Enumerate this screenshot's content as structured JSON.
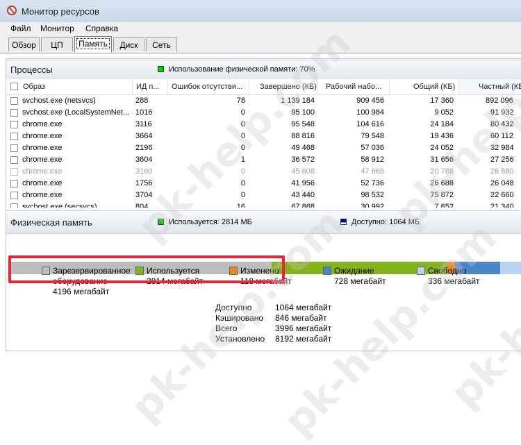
{
  "window": {
    "title": "Монитор ресурсов"
  },
  "menu": [
    "Файл",
    "Монитор",
    "Справка"
  ],
  "tabs": [
    {
      "label": "Обзор",
      "active": false
    },
    {
      "label": "ЦП",
      "active": false
    },
    {
      "label": "Память",
      "active": true
    },
    {
      "label": "Диск",
      "active": false
    },
    {
      "label": "Сеть",
      "active": false
    }
  ],
  "processes": {
    "title": "Процессы",
    "usage_label": "Использование физической памяти: 70%",
    "usage_color": "#00d000",
    "columns": [
      "Образ",
      "ИД п...",
      "Ошибок отсутстви...",
      "Завершено (КБ)",
      "Рабочий набо...",
      "Общий (КБ)",
      "Частный (КБ"
    ],
    "rows": [
      {
        "name": "svchost.exe (netsvcs)",
        "pid": "288",
        "faults": "78",
        "commit": "1 139 184",
        "working": "909 456",
        "shared": "17 360",
        "private": "892 096",
        "grey": false
      },
      {
        "name": "svchost.exe (LocalSystemNet...",
        "pid": "1016",
        "faults": "0",
        "commit": "95 100",
        "working": "100 984",
        "shared": "9 052",
        "private": "91 932",
        "grey": false
      },
      {
        "name": "chrome.exe",
        "pid": "3116",
        "faults": "0",
        "commit": "95 548",
        "working": "104 616",
        "shared": "24 184",
        "private": "80 432",
        "grey": false
      },
      {
        "name": "chrome.exe",
        "pid": "3664",
        "faults": "0",
        "commit": "88 816",
        "working": "79 548",
        "shared": "19 436",
        "private": "60 112",
        "grey": false
      },
      {
        "name": "chrome.exe",
        "pid": "2196",
        "faults": "0",
        "commit": "49 468",
        "working": "57 036",
        "shared": "24 052",
        "private": "32 984",
        "grey": false
      },
      {
        "name": "chrome.exe",
        "pid": "3604",
        "faults": "1",
        "commit": "36 572",
        "working": "58 912",
        "shared": "31 656",
        "private": "27 256",
        "grey": false
      },
      {
        "name": "chrome.exe",
        "pid": "3160",
        "faults": "0",
        "commit": "45 608",
        "working": "47 668",
        "shared": "20 788",
        "private": "26 880",
        "grey": true
      },
      {
        "name": "chrome.exe",
        "pid": "1756",
        "faults": "0",
        "commit": "41 956",
        "working": "52 736",
        "shared": "26 688",
        "private": "26 048",
        "grey": false
      },
      {
        "name": "chrome.exe",
        "pid": "3704",
        "faults": "0",
        "commit": "43 440",
        "working": "98 532",
        "shared": "75 872",
        "private": "22 660",
        "grey": false
      },
      {
        "name": "svchost.exe (secsvcs)",
        "pid": "804",
        "faults": "16",
        "commit": "67 868",
        "working": "30 992",
        "shared": "7 652",
        "private": "21 340",
        "grey": false
      }
    ]
  },
  "physical": {
    "title": "Физическая память",
    "used_label": "Используется: 2814 МБ",
    "used_color": "#00d000",
    "avail_label": "Доступно: 1064 МБ",
    "avail_color": "#0000cc",
    "bar": [
      {
        "name": "reserved",
        "mb": 4196,
        "color": "#bdbdbd"
      },
      {
        "name": "used",
        "mb": 2814,
        "color": "#84b31a"
      },
      {
        "name": "modified",
        "mb": 118,
        "color": "#e6881c"
      },
      {
        "name": "standby",
        "mb": 728,
        "color": "#4a86cc"
      },
      {
        "name": "free",
        "mb": 336,
        "color": "#b9d3ef"
      }
    ],
    "legend": [
      {
        "line1": "Зарезервированное",
        "line2": "оборудование",
        "line3": "4196 мегабайт",
        "color": "#bdbdbd"
      },
      {
        "line1": "Используется",
        "line2": "2814 мегабайт",
        "color": "#84b31a"
      },
      {
        "line1": "Изменено",
        "line2": "118 мегабайт",
        "color": "#e6881c"
      },
      {
        "line1": "Ожидание",
        "line2": "728 мегабайт",
        "color": "#4a86cc"
      },
      {
        "line1": "Свободно",
        "line2": "336 мегабайт",
        "color": "#b9d3ef"
      }
    ],
    "stats": [
      {
        "label": "Доступно",
        "value": "1064 мегабайт"
      },
      {
        "label": "Кэшировано",
        "value": "846 мегабайт"
      },
      {
        "label": "Всего",
        "value": "3996 мегабайт"
      },
      {
        "label": "Установлено",
        "value": "8192 мегабайт"
      }
    ]
  },
  "watermark": "pk-help.com",
  "highlight_color": "#e8243a"
}
